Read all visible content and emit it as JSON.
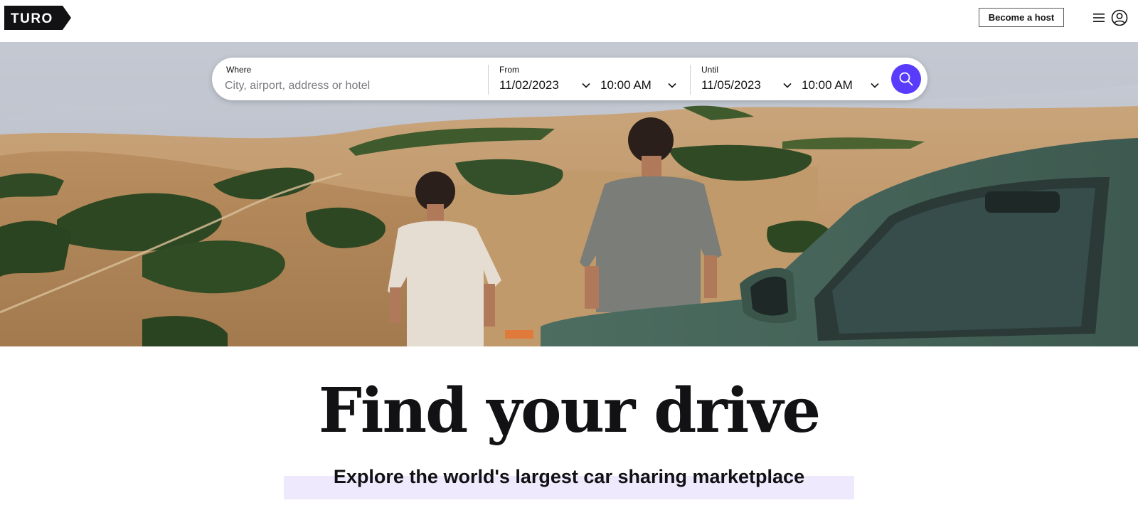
{
  "brand": {
    "logo_text": "TURO",
    "accent": "#593cfb"
  },
  "header": {
    "host_button_label": "Become a host",
    "menu_icon": "hamburger-menu-icon",
    "user_icon": "user-account-icon"
  },
  "search": {
    "where_label": "Where",
    "where_placeholder": "City, airport, address or hotel",
    "from_label": "From",
    "from_date": "11/02/2023",
    "from_time": "10:00 AM",
    "until_label": "Until",
    "until_date": "11/05/2023",
    "until_time": "10:00 AM",
    "search_icon": "magnifier-search-icon"
  },
  "hero": {
    "headline": "Find your drive",
    "subheadline": "Explore the world's largest car sharing marketplace",
    "highlight_color": "#efe9fd"
  }
}
